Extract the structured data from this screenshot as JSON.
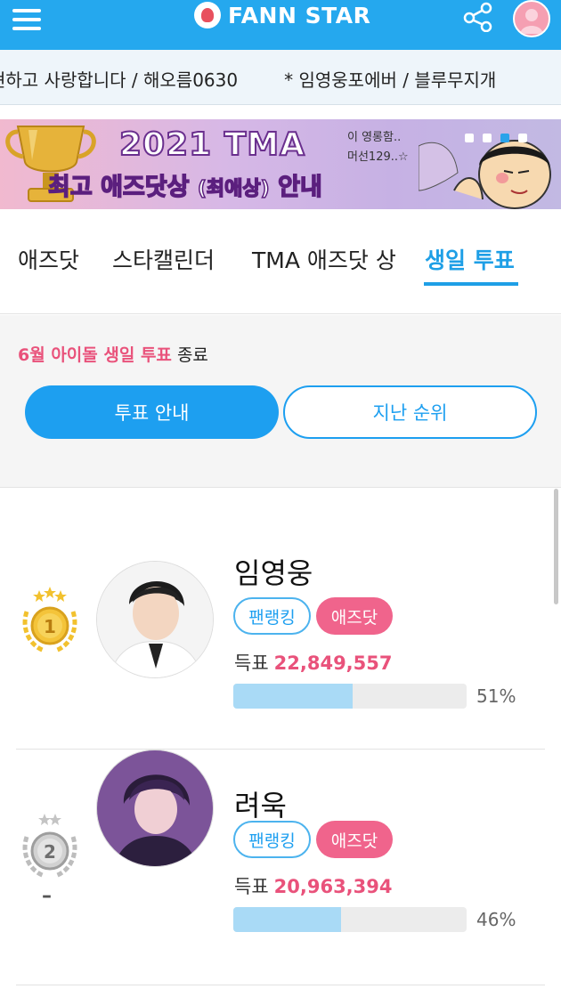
{
  "header": {
    "app_name": "FANN STAR",
    "menu_icon": "hamburger-icon",
    "share_icon": "share-icon",
    "profile_icon": "user-avatar-icon",
    "brand_color": "#25a8ee"
  },
  "ticker": {
    "item1": "현하고 사랑합니다 / 해오름0630",
    "item2": "* 임영웅포에버 / 블루무지개"
  },
  "banner": {
    "title": "2021 TMA",
    "subtitle_main": "최고 애즈닷상",
    "subtitle_paren": "(최애상)",
    "subtitle_tail": "안내",
    "bubble_line1": "이 영롱함..",
    "bubble_line2": "머선129..☆",
    "slide_count": 4,
    "active_slide": 3
  },
  "tabs": {
    "items": [
      {
        "label": "애즈닷"
      },
      {
        "label": "스타캘린더"
      },
      {
        "label": "TMA 애즈닷 상"
      },
      {
        "label": "생일 투표"
      }
    ],
    "active_index": 3
  },
  "info": {
    "notice_highlight": "6월 아이돌 생일 투표",
    "notice_tail": "종료",
    "btn_guide": "투표 안내",
    "btn_past": "지난 순위"
  },
  "ranking": [
    {
      "rank": "1",
      "name": "임영웅",
      "tag_fan": "팬랭킹",
      "tag_ads": "애즈닷",
      "votes_label": "득표",
      "votes": "22,849,557",
      "percent_text": "51%",
      "percent": 51,
      "medal_color": "gold",
      "rank_change": ""
    },
    {
      "rank": "2",
      "name": "려욱",
      "tag_fan": "팬랭킹",
      "tag_ads": "애즈닷",
      "votes_label": "득표",
      "votes": "20,963,394",
      "percent_text": "46%",
      "percent": 46,
      "medal_color": "silver",
      "rank_change": "–"
    }
  ],
  "colors": {
    "accent_blue": "#1d9ff0",
    "accent_pink": "#e9527b",
    "bar_fill": "#a9daf6"
  }
}
